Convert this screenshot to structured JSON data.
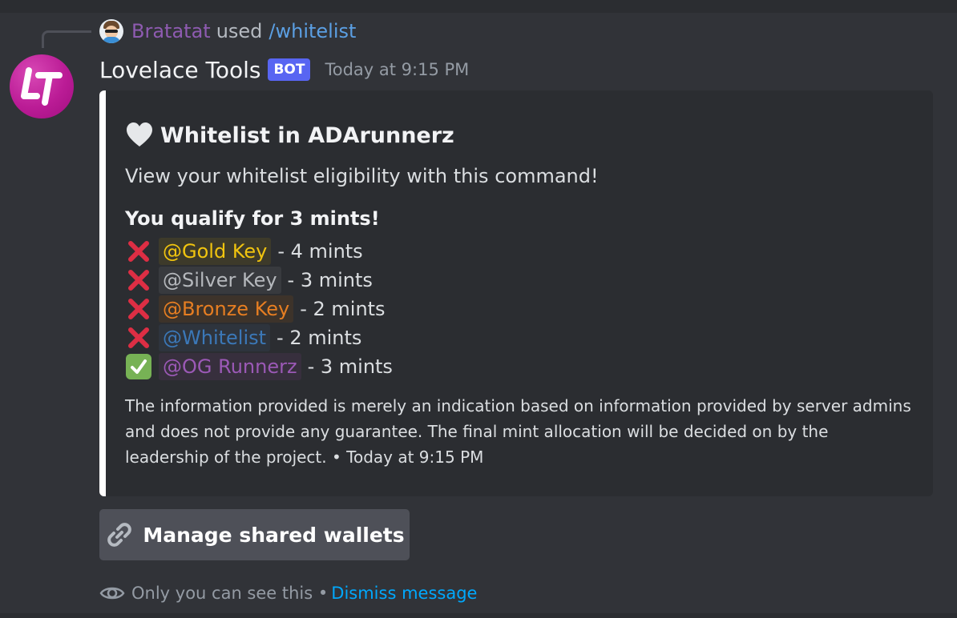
{
  "reply": {
    "user": "Bratatat",
    "used_text": "used",
    "command": "/whitelist"
  },
  "message": {
    "author": "Lovelace Tools",
    "badge": "BOT",
    "timestamp": "Today at 9:15 PM"
  },
  "embed": {
    "accent_color": "#ffffff",
    "title_icon": "white-heart-icon",
    "title": "Whitelist in ADArunnerz",
    "description": "View your whitelist eligibility with this command!",
    "qualify_text": "You qualify for 3 mints!",
    "roles": [
      {
        "status": "cross",
        "status_icon": "cross-mark-icon",
        "name": "@Gold Key",
        "color": "#f1c40f",
        "bg": "#3d3a2a",
        "suffix": "- 4 mints"
      },
      {
        "status": "cross",
        "status_icon": "cross-mark-icon",
        "name": "@Silver Key",
        "color": "#b5b8bc",
        "bg": "#383a3e",
        "suffix": "- 3 mints"
      },
      {
        "status": "cross",
        "status_icon": "cross-mark-icon",
        "name": "@Bronze Key",
        "color": "#e67e22",
        "bg": "#3d332a",
        "suffix": "- 2 mints"
      },
      {
        "status": "cross",
        "status_icon": "cross-mark-icon",
        "name": "@Whitelist",
        "color": "#3b78b8",
        "bg": "#2e343d",
        "suffix": "- 2 mints"
      },
      {
        "status": "check",
        "status_icon": "check-mark-icon",
        "name": "@OG Runnerz",
        "color": "#9b59b6",
        "bg": "#372f3d",
        "suffix": "- 3 mints"
      }
    ],
    "footer": "The information provided is merely an indication based on information provided by server admins and does not provide any guarantee. The final mint allocation will be decided on by the leadership of the project. • Today at 9:15 PM"
  },
  "button": {
    "icon": "link-icon",
    "label": "Manage shared wallets"
  },
  "ephemeral": {
    "icon": "eye-icon",
    "text": "Only you can see this •",
    "dismiss": "Dismiss message"
  }
}
